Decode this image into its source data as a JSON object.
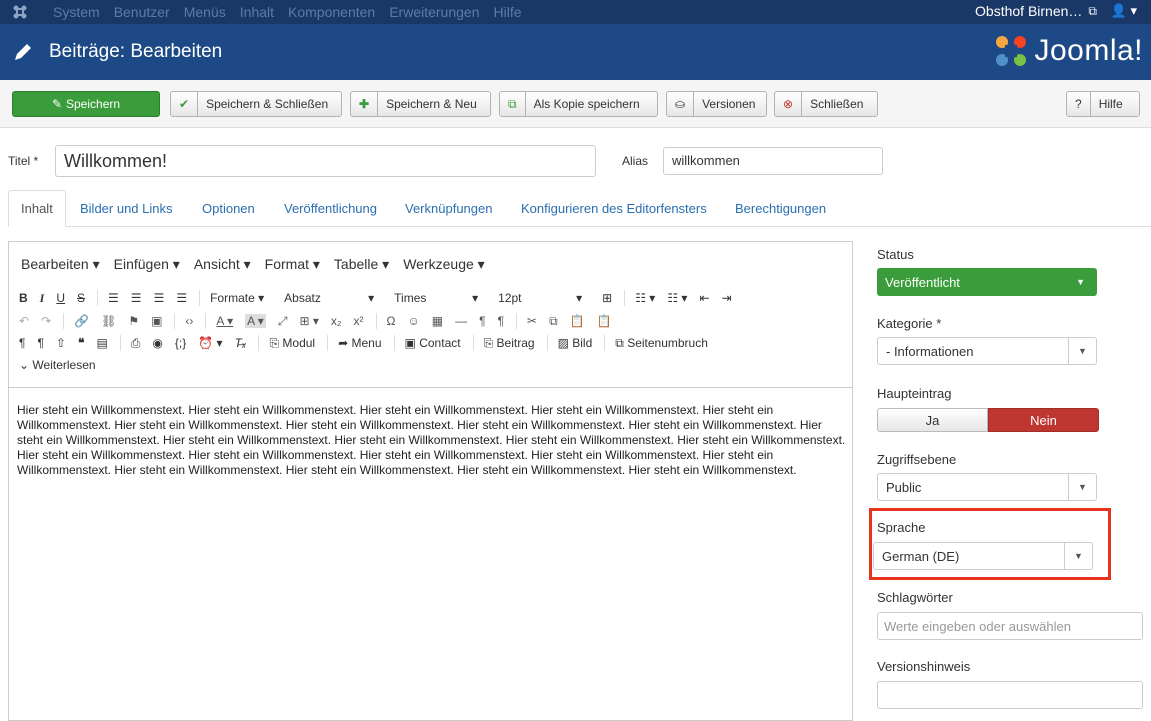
{
  "topbar": {
    "menu": [
      "System",
      "Benutzer",
      "Menüs",
      "Inhalt",
      "Komponenten",
      "Erweiterungen",
      "Hilfe"
    ],
    "site_name": "Obsthof Birnen…"
  },
  "header": {
    "title": "Beiträge: Bearbeiten",
    "brand": "Joomla!"
  },
  "toolbar": {
    "save": "Speichern",
    "save_close": "Speichern & Schließen",
    "save_new": "Speichern & Neu",
    "save_copy": "Als Kopie speichern",
    "versions": "Versionen",
    "close": "Schließen",
    "help": "Hilfe"
  },
  "form": {
    "title_label": "Titel *",
    "title_value": "Willkommen!",
    "alias_label": "Alias",
    "alias_value": "willkommen"
  },
  "tabs": [
    "Inhalt",
    "Bilder und Links",
    "Optionen",
    "Veröffentlichung",
    "Verknüpfungen",
    "Konfigurieren des Editorfensters",
    "Berechtigungen"
  ],
  "editor": {
    "menus": [
      "Bearbeiten ▾",
      "Einfügen ▾",
      "Ansicht ▾",
      "Format ▾",
      "Tabelle ▾",
      "Werkzeuge ▾"
    ],
    "formats_label": "Formate ▾",
    "block_label": "Absatz",
    "font_label": "Times",
    "size_label": "12pt",
    "btn_module": "Modul",
    "btn_menu": "Menu",
    "btn_contact": "Contact",
    "btn_article": "Beitrag",
    "btn_image": "Bild",
    "btn_pagebreak": "Seitenumbruch",
    "btn_readmore": "Weiterlesen",
    "body_text": "Hier steht ein Willkommenstext. Hier steht ein Willkommenstext. Hier steht ein Willkommenstext. Hier steht ein Willkommenstext. Hier steht ein Willkommenstext. Hier steht ein Willkommenstext. Hier steht ein Willkommenstext. Hier steht ein Willkommenstext. Hier steht ein Willkommenstext. Hier steht ein Willkommenstext. Hier steht ein Willkommenstext. Hier steht ein Willkommenstext. Hier steht ein Willkommenstext. Hier steht ein Willkommenstext. Hier steht ein Willkommenstext. Hier steht ein Willkommenstext. Hier steht ein Willkommenstext. Hier steht ein Willkommenstext. Hier steht ein Willkommenstext. Hier steht ein Willkommenstext. Hier steht ein Willkommenstext. Hier steht ein Willkommenstext. Hier steht ein Willkommenstext."
  },
  "sidebar": {
    "status_label": "Status",
    "status_value": "Veröffentlicht",
    "category_label": "Kategorie *",
    "category_value": "- Informationen",
    "featured_label": "Haupteintrag",
    "featured_yes": "Ja",
    "featured_no": "Nein",
    "access_label": "Zugriffsebene",
    "access_value": "Public",
    "language_label": "Sprache",
    "language_value": "German (DE)",
    "tags_label": "Schlagwörter",
    "tags_placeholder": "Werte eingeben oder auswählen",
    "version_note_label": "Versionshinweis",
    "version_note_value": ""
  },
  "colors": {
    "navbar": "#1a3867",
    "header": "#1d4a86",
    "success": "#3a9c3a",
    "danger": "#bd362f",
    "highlight": "#e8331c"
  }
}
